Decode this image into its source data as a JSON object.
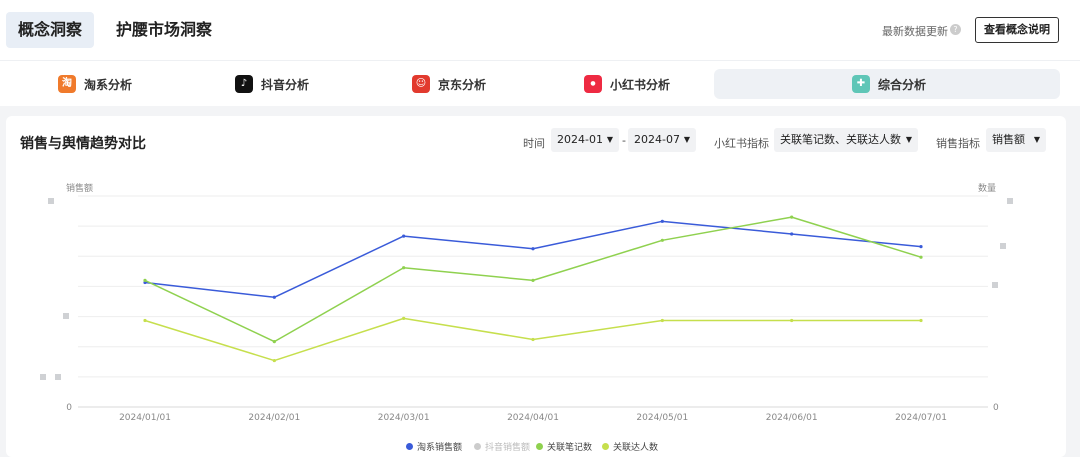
{
  "header": {
    "tabs": [
      {
        "label": "概念洞察"
      },
      {
        "label": "护腰市场洞察"
      }
    ],
    "update_text": "最新数据更新",
    "concept_button": "查看概念说明"
  },
  "platforms": [
    {
      "label": "淘系分析",
      "icon": "taobao-icon",
      "color": "#f07a2b"
    },
    {
      "label": "抖音分析",
      "icon": "douyin-icon",
      "color": "#111111"
    },
    {
      "label": "京东分析",
      "icon": "jd-icon",
      "color": "#e23a2e"
    },
    {
      "label": "小红书分析",
      "icon": "xiaohongshu-icon",
      "color": "#ee2a42"
    },
    {
      "label": "综合分析",
      "icon": "composite-icon",
      "color": "#5fc6b7"
    }
  ],
  "panel": {
    "title": "销售与舆情趋势对比",
    "time_label": "时间",
    "start": "2024-01",
    "end": "2024-07",
    "dash": "-",
    "xhs_label": "小红书指标",
    "xhs_value": "关联笔记数、关联达人数",
    "sales_label": "销售指标",
    "sales_value": "销售额"
  },
  "colors": {
    "accent": "#3a5bd9",
    "green": "#8fd14f",
    "yellowgreen": "#c6df4d",
    "disabled": "#cccccc"
  },
  "chart_data": {
    "type": "line",
    "x": [
      "2024/01/01",
      "2024/02/01",
      "2024/03/01",
      "2024/04/01",
      "2024/05/01",
      "2024/06/01",
      "2024/07/01"
    ],
    "y_left_label": "销售额",
    "y_right_label": "数量",
    "y_left_zero": "0",
    "y_right_zero": "0",
    "series": [
      {
        "name": "淘系销售额",
        "axis": "left",
        "color": "#3a5bd9",
        "visible": true,
        "values": [
          0.59,
          0.52,
          0.81,
          0.75,
          0.88,
          0.82,
          0.76
        ]
      },
      {
        "name": "抖音销售额",
        "axis": "left",
        "color": "#cccccc",
        "visible": false,
        "values": []
      },
      {
        "name": "关联笔记数",
        "axis": "right",
        "color": "#8fd14f",
        "visible": true,
        "values": [
          0.6,
          0.31,
          0.66,
          0.6,
          0.79,
          0.9,
          0.71
        ]
      },
      {
        "name": "关联达人数",
        "axis": "right",
        "color": "#c6df4d",
        "visible": true,
        "values": [
          0.41,
          0.22,
          0.42,
          0.32,
          0.41,
          0.41,
          0.41
        ]
      }
    ],
    "grid": true,
    "legend": "bottom-center"
  }
}
